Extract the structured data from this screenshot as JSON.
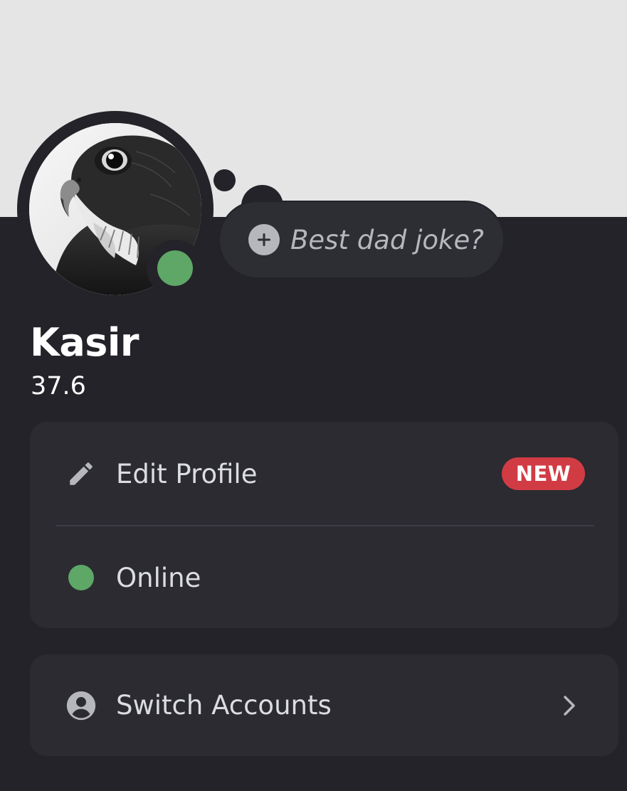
{
  "profile": {
    "display_name": "Kasir",
    "username": "37.6",
    "status_color": "#5ea766",
    "avatar_icon": "falcon-photo"
  },
  "custom_status": {
    "placeholder": "Best dad joke?",
    "icon": "plus-circle-icon"
  },
  "menu": {
    "edit_profile": {
      "label": "Edit Profile",
      "icon": "pencil-icon",
      "badge": "NEW",
      "badge_color": "#d13c44"
    },
    "status": {
      "label": "Online",
      "icon": "online-status-dot",
      "color": "#5ea766"
    },
    "switch_accounts": {
      "label": "Switch Accounts",
      "icon": "user-circle-icon",
      "trailing_icon": "chevron-right-icon"
    }
  },
  "colors": {
    "banner": "#e5e5e6",
    "background": "#232329",
    "card": "#2b2b31",
    "muted_text": "#b5b7bc"
  }
}
